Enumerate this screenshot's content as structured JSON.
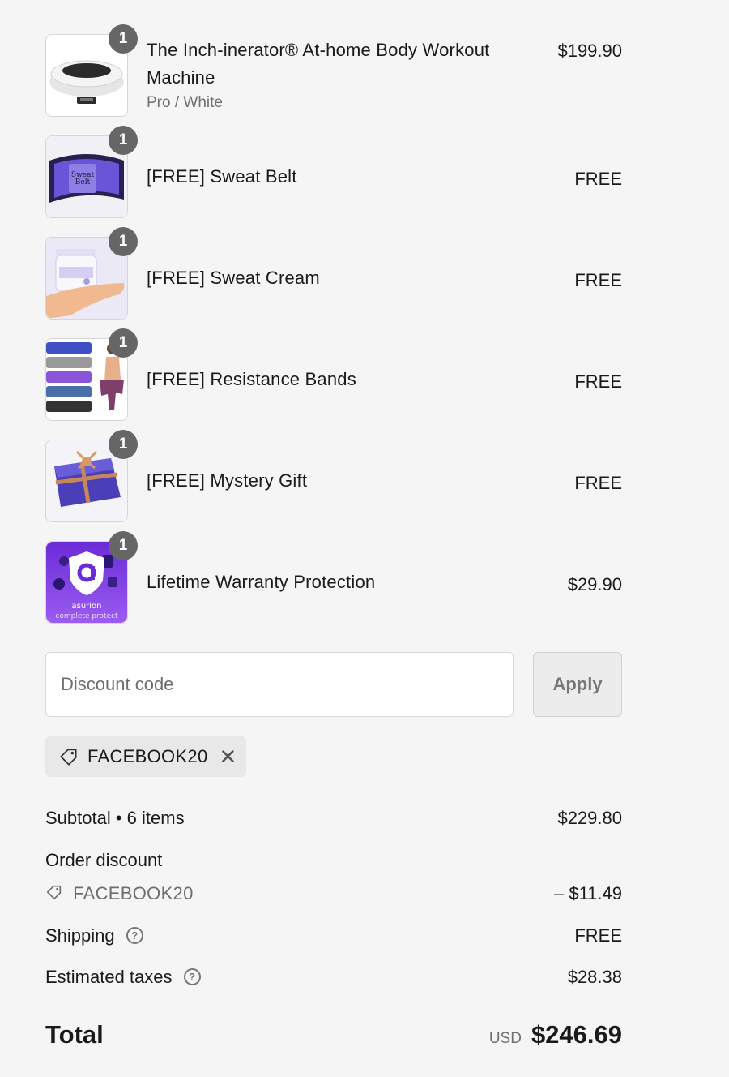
{
  "items": [
    {
      "title": "The Inch-inerator® At-home Body Workout Machine",
      "variant": "Pro / White",
      "price": "$199.90",
      "qty": "1",
      "icon": "vibration-plate-machine-image"
    },
    {
      "title": "[FREE] Sweat Belt",
      "price": "FREE",
      "qty": "1",
      "icon": "sweat-belt-image",
      "image_text": [
        "Sweat",
        "Belt"
      ]
    },
    {
      "title": "[FREE] Sweat Cream",
      "price": "FREE",
      "qty": "1",
      "icon": "sweat-cream-jar-image"
    },
    {
      "title": "[FREE] Resistance Bands",
      "price": "FREE",
      "qty": "1",
      "icon": "resistance-bands-image"
    },
    {
      "title": "[FREE] Mystery Gift",
      "price": "FREE",
      "qty": "1",
      "icon": "gift-box-image"
    },
    {
      "title": "Lifetime Warranty Protection",
      "price": "$29.90",
      "qty": "1",
      "icon": "asurion-logo-image",
      "image_text": [
        "asurion",
        "complete protect"
      ]
    }
  ],
  "discount": {
    "placeholder": "Discount code",
    "apply_label": "Apply",
    "applied_code": "FACEBOOK20"
  },
  "summary": {
    "subtotal_label": "Subtotal • 6 items",
    "subtotal_value": "$229.80",
    "order_discount_label": "Order discount",
    "order_discount_code": "FACEBOOK20",
    "order_discount_value": "– $11.49",
    "shipping_label": "Shipping",
    "shipping_value": "FREE",
    "taxes_label": "Estimated taxes",
    "taxes_value": "$28.38",
    "total_label": "Total",
    "currency": "USD",
    "total_value": "$246.69"
  }
}
